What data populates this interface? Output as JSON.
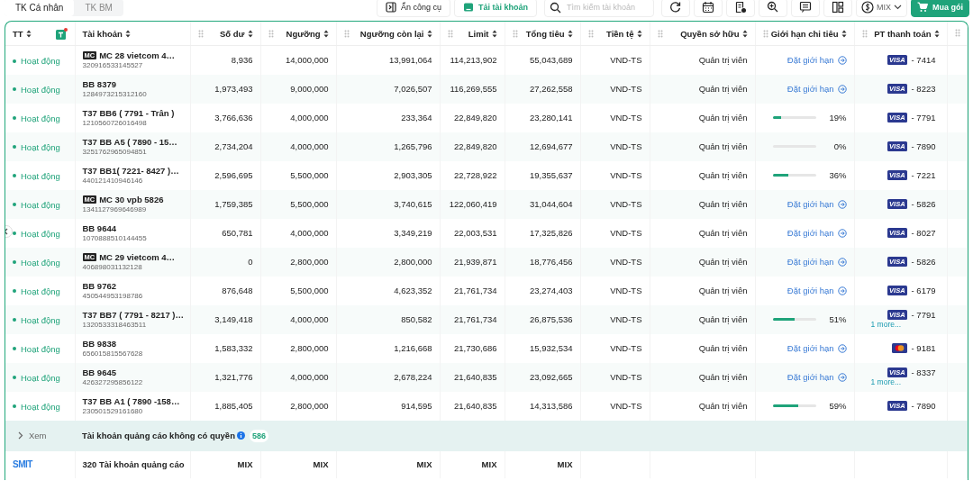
{
  "tabs": [
    {
      "label": "TK Cá nhân",
      "selected": true
    },
    {
      "label": "TK BM",
      "selected": false
    }
  ],
  "toolbar": {
    "hide_tools": "Ẩn công cụ",
    "download": "Tải tài khoản",
    "search": {
      "placeholder": "Tìm kiếm tài khoản"
    },
    "currency": "MIX",
    "buy": "Mua gói"
  },
  "table": {
    "columns": [
      "TT",
      "Tài khoản",
      "Số dư",
      "Ngưỡng",
      "Ngưỡng còn lại",
      "Limit",
      "Tổng tiêu",
      "Tiền tệ",
      "Quyền sở hữu",
      "Giới hạn chi tiêu",
      "PT thanh toán"
    ],
    "rows": [
      {
        "status": "Hoạt động",
        "badge": "MC",
        "name": "MC 28 vietcom 4…",
        "id": "320916533145527",
        "balance": "8,936",
        "threshold": "14,000,000",
        "remaining": "13,991,064",
        "limit": "114,213,902",
        "spent": "55,043,689",
        "currency": "VND-TS",
        "role": "Quản trị viên",
        "spend_limit": {
          "kind": "link",
          "text": "Đặt giới hạn"
        },
        "payment": {
          "card": {
            "kind": "visa",
            "label": "VISA"
          },
          "digits": "- 7414"
        }
      },
      {
        "status": "Hoạt động",
        "name": "BB 8379",
        "id": "1284973215312160",
        "balance": "1,973,493",
        "threshold": "9,000,000",
        "remaining": "7,026,507",
        "limit": "116,269,555",
        "spent": "27,262,558",
        "currency": "VND-TS",
        "role": "Quản trị viên",
        "spend_limit": {
          "kind": "link",
          "text": "Đặt giới hạn"
        },
        "payment": {
          "card": {
            "kind": "visa",
            "label": "VISA"
          },
          "digits": "- 8223"
        }
      },
      {
        "status": "Hoạt động",
        "name": "T37 BB6 ( 7791 - Trân )",
        "id": "1210560726016498",
        "balance": "3,766,636",
        "threshold": "4,000,000",
        "remaining": "233,364",
        "limit": "22,849,820",
        "spent": "23,280,141",
        "currency": "VND-TS",
        "role": "Quản trị viên",
        "spend_limit": {
          "kind": "progress",
          "level": 0.19,
          "text": "19%"
        },
        "payment": {
          "card": {
            "kind": "visa",
            "label": "VISA"
          },
          "digits": "- 7791"
        }
      },
      {
        "status": "Hoạt động",
        "name": "T37 BB A5 ( 7890 - 15…",
        "id": "3251762965094851",
        "balance": "2,734,204",
        "threshold": "4,000,000",
        "remaining": "1,265,796",
        "limit": "22,849,820",
        "spent": "12,694,677",
        "currency": "VND-TS",
        "role": "Quản trị viên",
        "spend_limit": {
          "kind": "progress",
          "level": 0,
          "text": "0%"
        },
        "payment": {
          "card": {
            "kind": "visa",
            "label": "VISA"
          },
          "digits": "- 7890"
        }
      },
      {
        "status": "Hoạt động",
        "name": "T37 BB1( 7221- 8427 )…",
        "id": "440121410946146",
        "balance": "2,596,695",
        "threshold": "5,500,000",
        "remaining": "2,903,305",
        "limit": "22,728,922",
        "spent": "19,355,637",
        "currency": "VND-TS",
        "role": "Quản trị viên",
        "spend_limit": {
          "kind": "progress",
          "level": 0.36,
          "text": "36%"
        },
        "payment": {
          "card": {
            "kind": "visa",
            "label": "VISA"
          },
          "digits": "- 7221"
        }
      },
      {
        "status": "Hoạt động",
        "badge": "MC",
        "name": "MC 30 vpb 5826",
        "id": "1341127969646989",
        "balance": "1,759,385",
        "threshold": "5,500,000",
        "remaining": "3,740,615",
        "limit": "122,060,419",
        "spent": "31,044,604",
        "currency": "VND-TS",
        "role": "Quản trị viên",
        "spend_limit": {
          "kind": "link",
          "text": "Đặt giới hạn"
        },
        "payment": {
          "card": {
            "kind": "visa",
            "label": "VISA"
          },
          "digits": "- 5826"
        }
      },
      {
        "status": "Hoạt động",
        "name": "BB 9644",
        "id": "1070888510144455",
        "balance": "650,781",
        "threshold": "4,000,000",
        "remaining": "3,349,219",
        "limit": "22,003,531",
        "spent": "17,325,826",
        "currency": "VND-TS",
        "role": "Quản trị viên",
        "spend_limit": {
          "kind": "link",
          "text": "Đặt giới hạn"
        },
        "payment": {
          "card": {
            "kind": "visa",
            "label": "VISA"
          },
          "digits": "- 8027"
        }
      },
      {
        "status": "Hoạt động",
        "badge": "MC",
        "name": "MC 29 vietcom 4…",
        "id": "406898031132128",
        "balance": "0",
        "threshold": "2,800,000",
        "remaining": "2,800,000",
        "limit": "21,939,871",
        "spent": "18,776,456",
        "currency": "VND-TS",
        "role": "Quản trị viên",
        "spend_limit": {
          "kind": "link",
          "text": "Đặt giới hạn"
        },
        "payment": {
          "card": {
            "kind": "visa",
            "label": "VISA"
          },
          "digits": "- 5826"
        }
      },
      {
        "status": "Hoạt động",
        "name": "BB 9762",
        "id": "450544953198786",
        "balance": "876,648",
        "threshold": "5,500,000",
        "remaining": "4,623,352",
        "limit": "21,761,734",
        "spent": "23,274,403",
        "currency": "VND-TS",
        "role": "Quản trị viên",
        "spend_limit": {
          "kind": "link",
          "text": "Đặt giới hạn"
        },
        "payment": {
          "card": {
            "kind": "visa",
            "label": "VISA"
          },
          "digits": "- 6179"
        }
      },
      {
        "status": "Hoạt động",
        "name": "T37 BB7 ( 7791 - 8217 )…",
        "id": "1320533318463511",
        "balance": "3,149,418",
        "threshold": "4,000,000",
        "remaining": "850,582",
        "limit": "21,761,734",
        "spent": "26,875,536",
        "currency": "VND-TS",
        "role": "Quản trị viên",
        "spend_limit": {
          "kind": "progress",
          "level": 0.51,
          "text": "51%"
        },
        "payment": {
          "card": {
            "kind": "visa",
            "label": "VISA"
          },
          "digits": "- 7791",
          "more": "1 more..."
        }
      },
      {
        "status": "Hoạt động",
        "name": "BB 9838",
        "id": "656015815567628",
        "balance": "1,583,332",
        "threshold": "2,800,000",
        "remaining": "1,216,668",
        "limit": "21,730,686",
        "spent": "15,932,534",
        "currency": "VND-TS",
        "role": "Quản trị viên",
        "spend_limit": {
          "kind": "link",
          "text": "Đặt giới hạn"
        },
        "payment": {
          "card": {
            "kind": "mastercard"
          },
          "digits": "- 9181"
        }
      },
      {
        "status": "Hoạt động",
        "name": "BB 9645",
        "id": "426327295856122",
        "balance": "1,321,776",
        "threshold": "4,000,000",
        "remaining": "2,678,224",
        "limit": "21,640,835",
        "spent": "23,092,665",
        "currency": "VND-TS",
        "role": "Quản trị viên",
        "spend_limit": {
          "kind": "link",
          "text": "Đặt giới hạn"
        },
        "payment": {
          "card": {
            "kind": "visa",
            "label": "VISA"
          },
          "digits": "- 8337",
          "more": "1 more..."
        }
      },
      {
        "status": "Hoạt động",
        "name": "T37 BB A1 ( 7890 -158…",
        "id": "230501529161680",
        "balance": "1,885,405",
        "threshold": "2,800,000",
        "remaining": "914,595",
        "limit": "21,640,835",
        "spent": "14,313,586",
        "currency": "VND-TS",
        "role": "Quản trị viên",
        "spend_limit": {
          "kind": "progress",
          "level": 0.59,
          "text": "59%"
        },
        "payment": {
          "card": {
            "kind": "visa",
            "label": "VISA"
          },
          "digits": "- 7890"
        }
      }
    ],
    "hidden_group": {
      "toggle": "Xem",
      "label": "Tài khoản quảng cáo không có quyền",
      "count": "586"
    },
    "footer": {
      "logo": "SMIT",
      "total": "320 Tài khoản quảng cáo",
      "values": [
        "MIX",
        "MIX",
        "MIX",
        "MIX",
        "MIX"
      ]
    }
  }
}
